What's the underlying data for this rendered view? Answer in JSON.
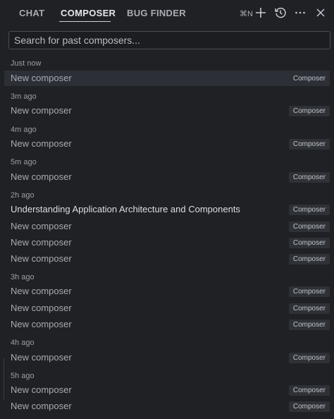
{
  "header": {
    "tabs": [
      {
        "label": "CHAT"
      },
      {
        "label": "COMPOSER"
      },
      {
        "label": "BUG FINDER"
      }
    ],
    "shortcut": "⌘N",
    "icons": [
      "plus-icon",
      "history-icon",
      "more-icon",
      "close-icon"
    ]
  },
  "search": {
    "placeholder": "Search for past composers..."
  },
  "groups": [
    {
      "label": "Just now",
      "items": [
        {
          "title": "New composer",
          "badge": "Composer",
          "selected": true
        }
      ]
    },
    {
      "label": "3m ago",
      "items": [
        {
          "title": "New composer",
          "badge": "Composer"
        }
      ]
    },
    {
      "label": "4m ago",
      "items": [
        {
          "title": "New composer",
          "badge": "Composer"
        }
      ]
    },
    {
      "label": "5m ago",
      "items": [
        {
          "title": "New composer",
          "badge": "Composer"
        }
      ]
    },
    {
      "label": "2h ago",
      "items": [
        {
          "title": "Understanding Application Architecture and Components",
          "badge": "Composer",
          "highlight": true
        },
        {
          "title": "New composer",
          "badge": "Composer"
        },
        {
          "title": "New composer",
          "badge": "Composer"
        },
        {
          "title": "New composer",
          "badge": "Composer"
        }
      ]
    },
    {
      "label": "3h ago",
      "items": [
        {
          "title": "New composer",
          "badge": "Composer"
        },
        {
          "title": "New composer",
          "badge": "Composer"
        },
        {
          "title": "New composer",
          "badge": "Composer"
        }
      ]
    },
    {
      "label": "4h ago",
      "items": [
        {
          "title": "New composer",
          "badge": "Composer"
        }
      ]
    },
    {
      "label": "5h ago",
      "items": [
        {
          "title": "New composer",
          "badge": "Composer"
        },
        {
          "title": "New composer",
          "badge": "Composer"
        }
      ]
    }
  ],
  "colors": {
    "background": "#1f2125",
    "selected_row": "#2c2f35",
    "badge_bg": "#2e3136"
  }
}
